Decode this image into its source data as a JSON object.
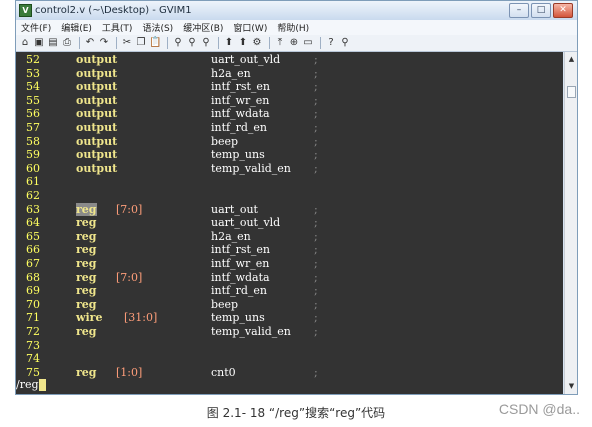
{
  "window": {
    "title": "control2.v (~\\Desktop) - GVIM1",
    "controls": [
      "–",
      "□",
      "✕"
    ]
  },
  "menubar": [
    "文件(F)",
    "编辑(E)",
    "工具(T)",
    "语法(S)",
    "缓冲区(B)",
    "窗口(W)",
    "帮助(H)"
  ],
  "toolbar_icons": [
    "open-icon",
    "save-icon",
    "save-all-icon",
    "print-icon",
    "undo-icon",
    "redo-icon",
    "cut-icon",
    "copy-icon",
    "paste-icon",
    "find-icon",
    "find-next-icon",
    "find-prev-icon",
    "load-session-icon",
    "save-session-icon",
    "run-script-icon",
    "make-icon",
    "shell-icon",
    "tags-icon",
    "help-icon",
    "find-help-icon"
  ],
  "toolbar_glyphs": [
    "⌂",
    "▣",
    "▤",
    "⎙",
    "↶",
    "↷",
    "✂",
    "❐",
    "📋",
    "⚲",
    "⚲",
    "⚲",
    "⬆",
    "⬆",
    "⚙",
    "⤒",
    "⊕",
    "▭",
    "?",
    "⚲"
  ],
  "editor": {
    "lines": [
      {
        "n": "52",
        "kw": "output",
        "range": "",
        "sig": "uart_out_vld",
        "semi": ";"
      },
      {
        "n": "53",
        "kw": "output",
        "range": "",
        "sig": "h2a_en",
        "semi": ";"
      },
      {
        "n": "54",
        "kw": "output",
        "range": "",
        "sig": "intf_rst_en",
        "semi": ";"
      },
      {
        "n": "55",
        "kw": "output",
        "range": "",
        "sig": "intf_wr_en",
        "semi": ";"
      },
      {
        "n": "56",
        "kw": "output",
        "range": "",
        "sig": "intf_wdata",
        "semi": ";"
      },
      {
        "n": "57",
        "kw": "output",
        "range": "",
        "sig": "intf_rd_en",
        "semi": ";"
      },
      {
        "n": "58",
        "kw": "output",
        "range": "",
        "sig": "beep",
        "semi": ";"
      },
      {
        "n": "59",
        "kw": "output",
        "range": "",
        "sig": "temp_uns",
        "semi": ";"
      },
      {
        "n": "60",
        "kw": "output",
        "range": "",
        "sig": "temp_valid_en",
        "semi": ";"
      },
      {
        "n": "61",
        "kw": "",
        "range": "",
        "sig": "",
        "semi": ""
      },
      {
        "n": "62",
        "kw": "",
        "range": "",
        "sig": "",
        "semi": ""
      },
      {
        "n": "63",
        "kw": "reg",
        "range": "[7:0]",
        "sig": "uart_out",
        "semi": ";",
        "highlight": true
      },
      {
        "n": "64",
        "kw": "reg",
        "range": "",
        "sig": "uart_out_vld",
        "semi": ";"
      },
      {
        "n": "65",
        "kw": "reg",
        "range": "",
        "sig": "h2a_en",
        "semi": ";"
      },
      {
        "n": "66",
        "kw": "reg",
        "range": "",
        "sig": "intf_rst_en",
        "semi": ";"
      },
      {
        "n": "67",
        "kw": "reg",
        "range": "",
        "sig": "intf_wr_en",
        "semi": ";"
      },
      {
        "n": "68",
        "kw": "reg",
        "range": "[7:0]",
        "sig": "intf_wdata",
        "semi": ";"
      },
      {
        "n": "69",
        "kw": "reg",
        "range": "",
        "sig": "intf_rd_en",
        "semi": ";"
      },
      {
        "n": "70",
        "kw": "reg",
        "range": "",
        "sig": "beep",
        "semi": ";"
      },
      {
        "n": "71",
        "kw": "wire",
        "range": "[31:0]",
        "sig": "temp_uns",
        "semi": ";"
      },
      {
        "n": "72",
        "kw": "reg",
        "range": "",
        "sig": "temp_valid_en",
        "semi": ";"
      },
      {
        "n": "73",
        "kw": "",
        "range": "",
        "sig": "",
        "semi": ""
      },
      {
        "n": "74",
        "kw": "",
        "range": "",
        "sig": "",
        "semi": ""
      },
      {
        "n": "75",
        "kw": "reg",
        "range": "[1:0]",
        "sig": "cnt0",
        "semi": ";"
      }
    ],
    "command_line": "/reg"
  },
  "scrollbar": {
    "up": "▲",
    "down": "▼"
  },
  "caption": "图 2.1- 18 “/reg”搜索“reg”代码",
  "watermark": "CSDN @da.."
}
